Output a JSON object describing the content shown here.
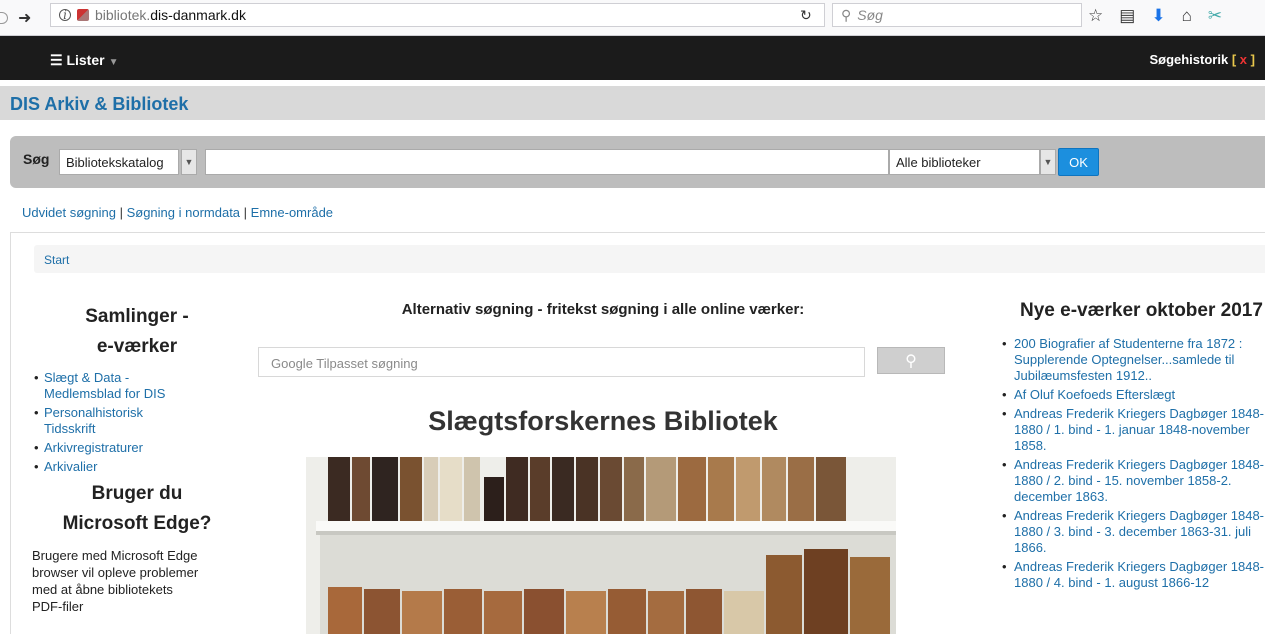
{
  "browser": {
    "url_prefix": "bibliotek.",
    "url_domain": "dis-danmark.dk",
    "search_placeholder": "Søg"
  },
  "navbar": {
    "menu_label": "Lister",
    "history_label": "Søgehistorik",
    "history_close": "x"
  },
  "site": {
    "title": "DIS Arkiv & Bibliotek"
  },
  "search": {
    "label": "Søg",
    "type_value": "Bibliotekskatalog",
    "query_value": "",
    "library_value": "Alle biblioteker",
    "ok_label": "OK"
  },
  "links": [
    "Udvidet søgning",
    "Søgning i normdata",
    "Emne-område"
  ],
  "breadcrumb": "Start",
  "left": {
    "heading1": "Samlinger -",
    "heading2": "e-værker",
    "items": [
      "Slægt & Data - Medlemsblad for DIS",
      "Personalhistorisk Tidsskrift",
      "Arkivregistraturer",
      "Arkivalier"
    ],
    "edge_heading1": "Bruger du",
    "edge_heading2": "Microsoft Edge?",
    "edge_text": "Brugere med Microsoft Edge browser vil opleve problemer med at åbne bibliotekets PDF-filer"
  },
  "center": {
    "heading": "Alternativ søgning - fritekst søgning i alle online værker:",
    "google_placeholder": "Google Tilpasset søgning",
    "big_title": "Slægtsforskernes Bibliotek"
  },
  "right": {
    "heading": "Nye e-værker oktober 2017",
    "items": [
      "200 Biografier af Studenterne fra 1872 : Supplerende Optegnelser...samlede til Jubilæumsfesten 1912..",
      "Af Oluf Koefoeds Efterslægt",
      "Andreas Frederik Kriegers Dagbøger 1848-1880 / 1. bind - 1. januar 1848-november 1858.",
      "Andreas Frederik Kriegers Dagbøger 1848-1880 / 2. bind - 15. november 1858-2. december 1863.",
      "Andreas Frederik Kriegers Dagbøger 1848-1880 / 3. bind - 3. december 1863-31. juli 1866.",
      "Andreas Frederik Kriegers Dagbøger 1848-1880 / 4. bind - 1. august 1866-12"
    ]
  }
}
